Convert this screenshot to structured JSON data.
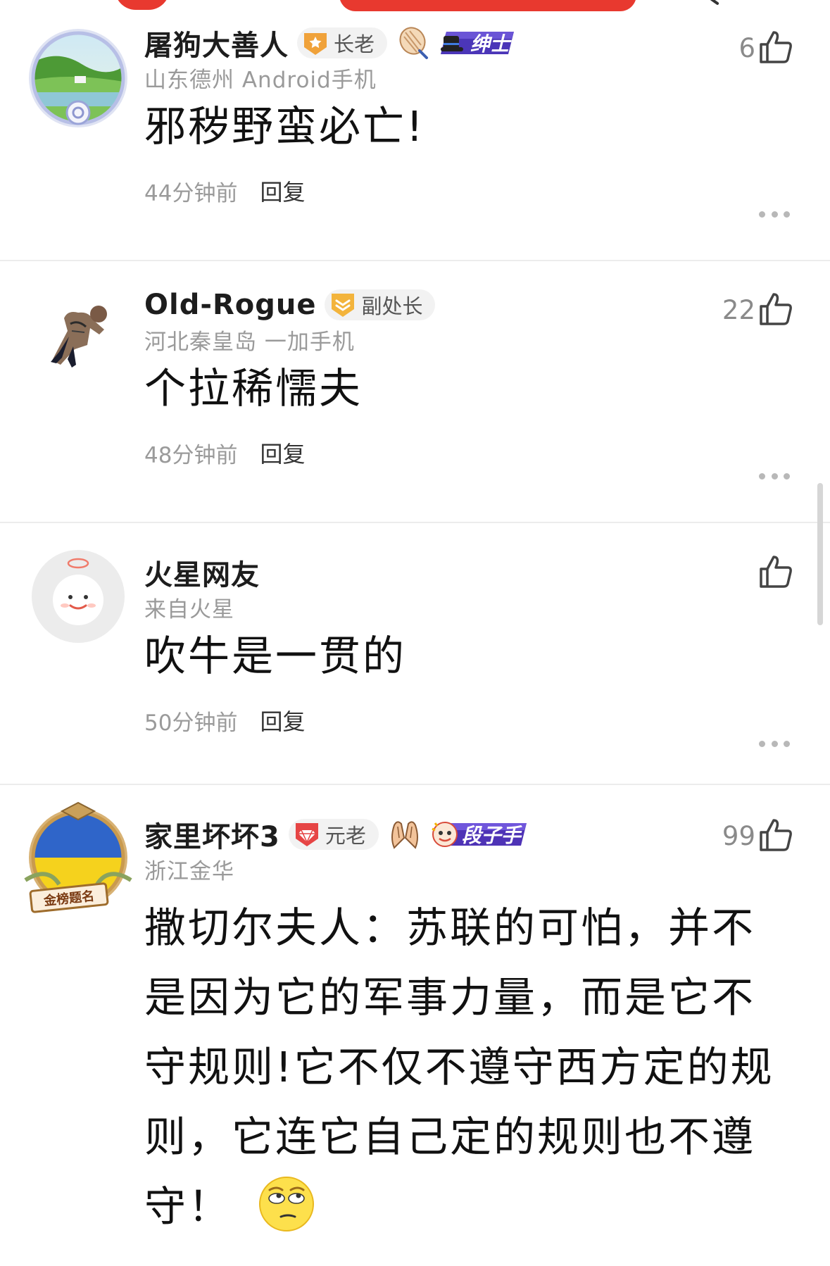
{
  "comments": [
    {
      "username": "屠狗大善人",
      "rank": "长老",
      "title_tag": "绅士",
      "location": "山东德州  Android手机",
      "text": "邪秽野蛮必亡!",
      "time": "44分钟前",
      "reply": "回复",
      "likes": "6"
    },
    {
      "username": "Old-Rogue",
      "rank": "副处长",
      "location": "河北秦皇岛  一加手机",
      "text": "个拉稀懦夫",
      "time": "48分钟前",
      "reply": "回复",
      "likes": "22"
    },
    {
      "username": "火星网友",
      "location": "来自火星",
      "text": "吹牛是一贯的",
      "time": "50分钟前",
      "reply": "回复",
      "likes": ""
    },
    {
      "username": "家里坏坏3",
      "rank": "元老",
      "title_tag": "段子手",
      "avatar_frame_label": "金榜题名",
      "location": "浙江金华",
      "text": "撒切尔夫人：苏联的可怕，并不是因为它的军事力量，而是它不守规则!它不仅不遵守西方定的规则，它连它自己定的规则也不遵守！",
      "likes": "99"
    }
  ],
  "colors": {
    "accent_red": "#e8392f",
    "rank_gold": "#f0a23a",
    "rank_red": "#e64545",
    "title_purple": "#5b3fc4",
    "meta_gray": "#9a9a9a"
  },
  "icons": [
    "thumbs-up-icon",
    "more-dots-icon",
    "star-rank-icon",
    "shield-rank-icon",
    "diamond-rank-icon",
    "leaf-medal-icon",
    "clap-hands-icon",
    "eye-roll-emoji-icon"
  ]
}
